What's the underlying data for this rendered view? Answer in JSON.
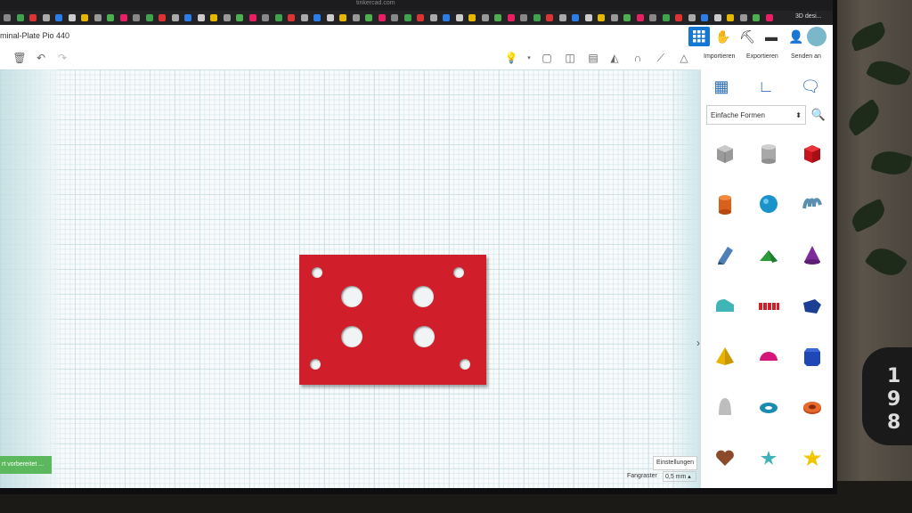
{
  "browser": {
    "url": "tinkercad.com",
    "bookmark_last": "3D desi..."
  },
  "app": {
    "title": "minal-Plate Pio 440"
  },
  "actions": {
    "import": "Importieren",
    "export": "Exportieren",
    "send": "Senden an"
  },
  "panel": {
    "category": "Einfache Formen",
    "shapes": [
      "box-striped",
      "cylinder-striped",
      "box",
      "cylinder",
      "sphere",
      "scribble",
      "text-pen",
      "roof",
      "cone",
      "round-roof",
      "text",
      "polygon",
      "pyramid",
      "half-sphere",
      "hexagonal-prism",
      "paraboloid",
      "torus",
      "tube",
      "heart",
      "star",
      "star-yellow"
    ]
  },
  "workplane": {
    "status_button": "rt vorbereitet ...",
    "settings": "Einstellungen",
    "snap_label": "Fangraster",
    "snap_value": "0,5 mm"
  },
  "colors": {
    "accent": "#1477d4",
    "plate": "#d01f2a",
    "status": "#5cb85c"
  }
}
